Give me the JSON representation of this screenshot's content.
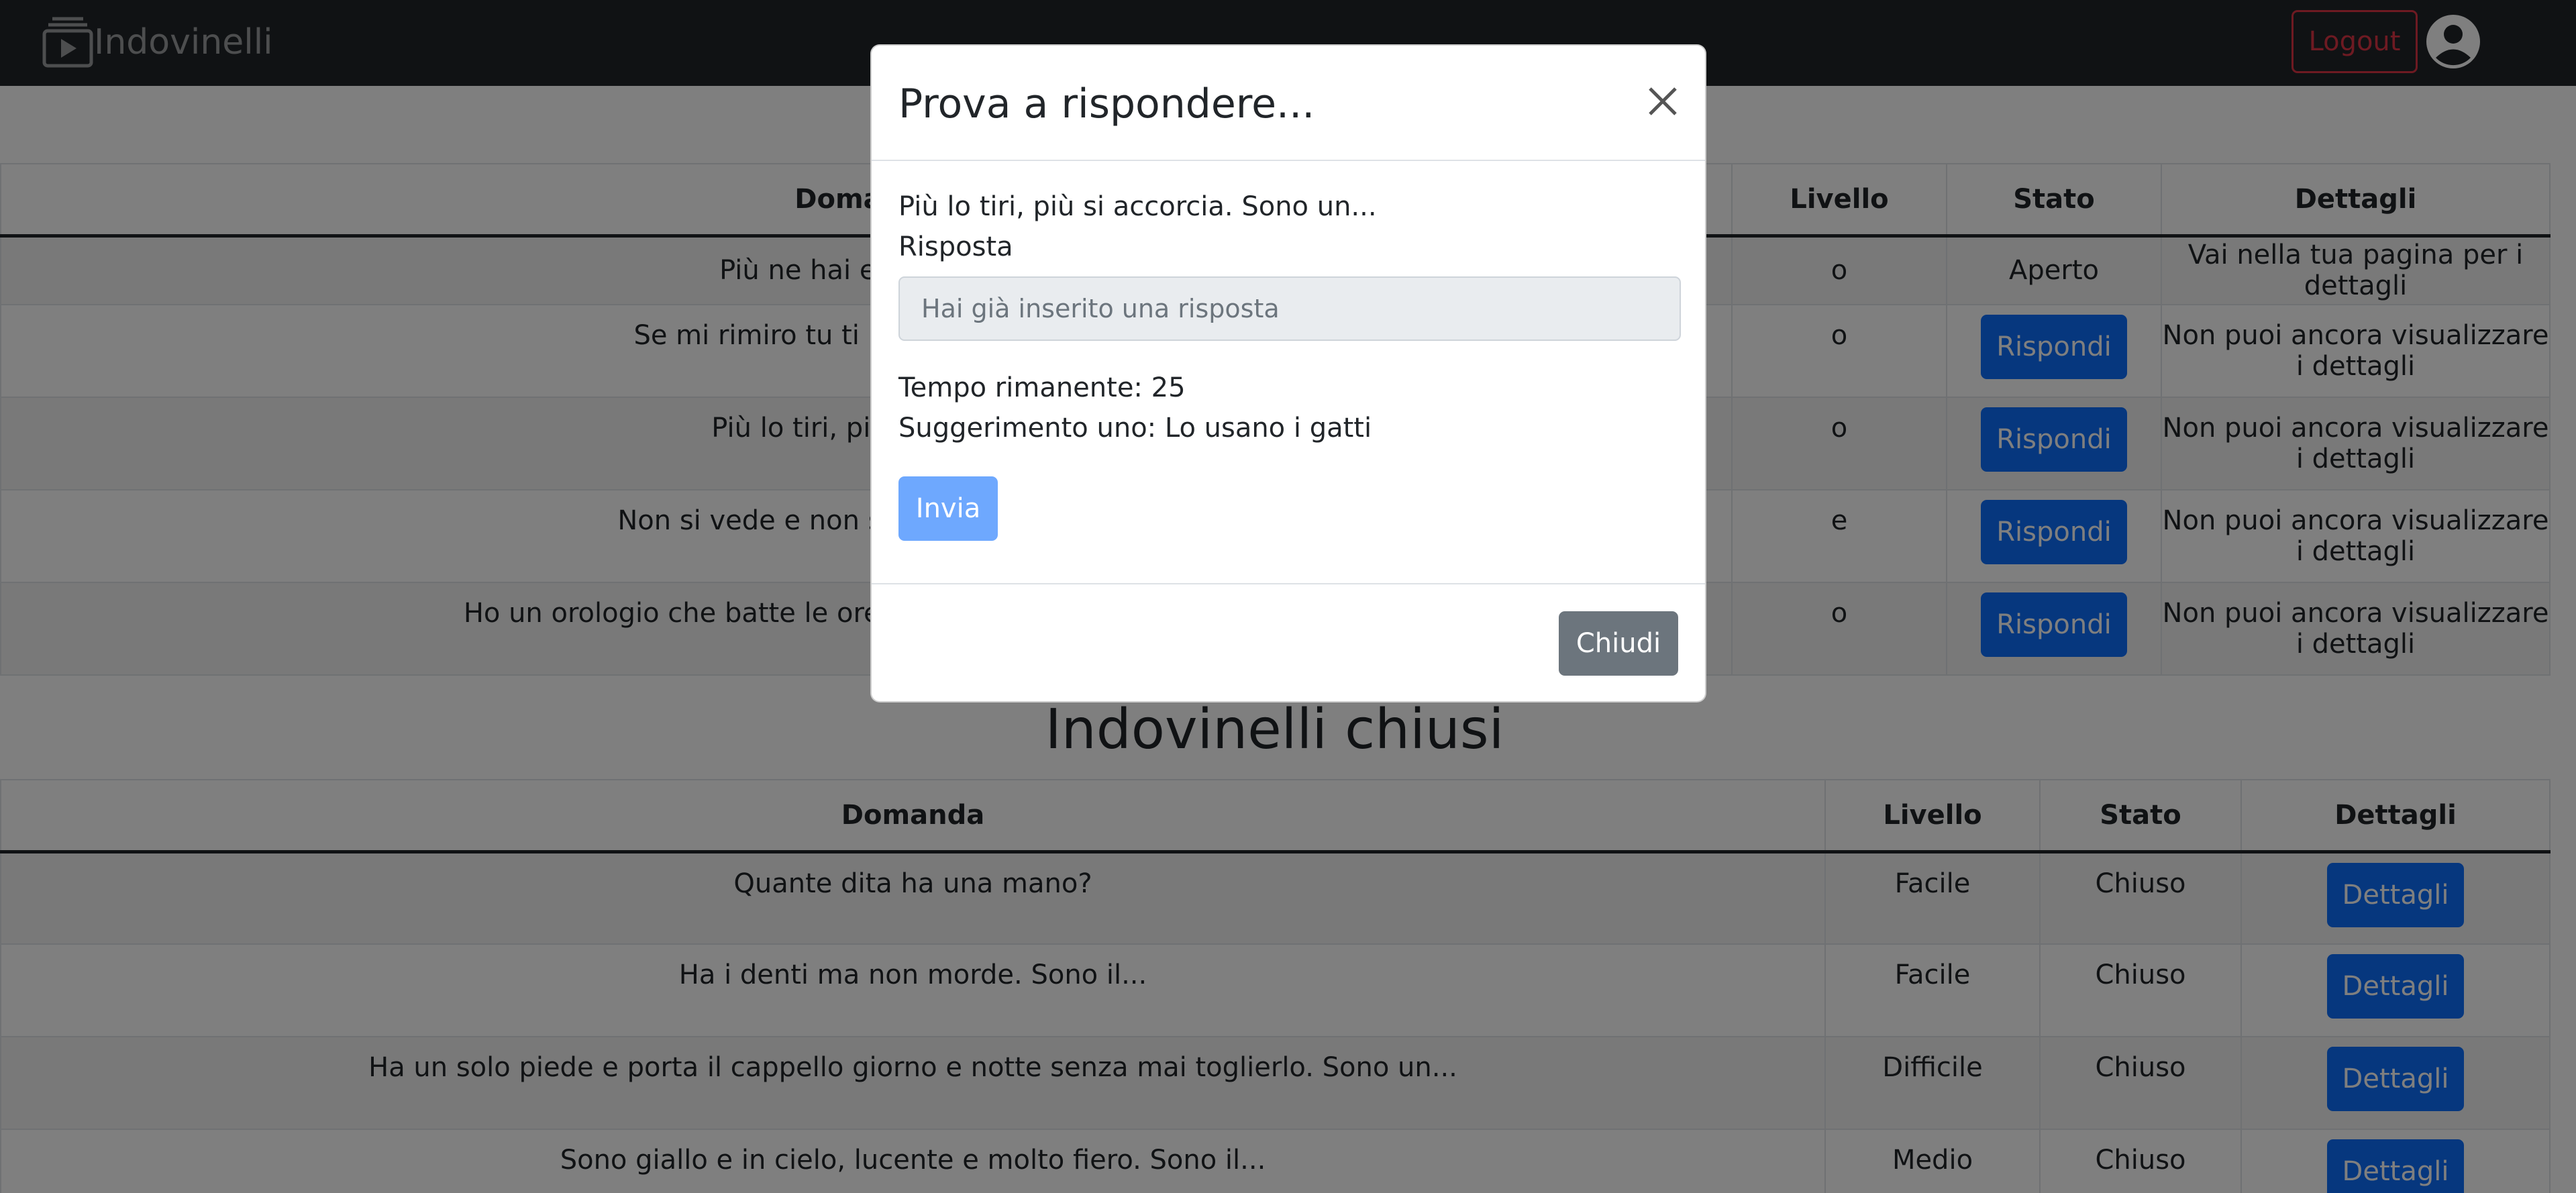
{
  "navbar": {
    "brand": "Indovinelli",
    "logout_label": "Logout"
  },
  "open_table": {
    "headers": [
      "Domanda",
      "Livello",
      "Stato",
      "Dettagli"
    ],
    "rows": [
      {
        "question": "Più ne hai e meno ten",
        "level": "o",
        "state": "Aperto",
        "details": "Vai nella tua pagina per i dettagli"
      },
      {
        "question": "Se mi rimiro tu ti rimiri; se io mi rit",
        "level": "o",
        "action": "Rispondi",
        "details": "Non puoi ancora visualizzare i dettagli"
      },
      {
        "question": "Più lo tiri, più si accorci",
        "level": "o",
        "action": "Rispondi",
        "details": "Non puoi ancora visualizzare i dettagli"
      },
      {
        "question": "Non si vede e non si tocca, esce sem",
        "level": "e",
        "action": "Rispondi",
        "details": "Non puoi ancora visualizzare i dettagli"
      },
      {
        "question": "Ho un orologio che batte le ore, non ha le lancette e quadra",
        "level": "o",
        "action": "Rispondi",
        "details": "Non puoi ancora visualizzare i dettagli"
      }
    ]
  },
  "closed_section": {
    "title": "Indovinelli chiusi"
  },
  "closed_table": {
    "headers": [
      "Domanda",
      "Livello",
      "Stato",
      "Dettagli"
    ],
    "rows": [
      {
        "question": "Quante dita ha una mano?",
        "level": "Facile",
        "state": "Chiuso",
        "action": "Dettagli"
      },
      {
        "question": "Ha i denti ma non morde. Sono il...",
        "level": "Facile",
        "state": "Chiuso",
        "action": "Dettagli"
      },
      {
        "question": "Ha un solo piede e porta il cappello giorno e notte senza mai toglierlo. Sono un...",
        "level": "Difficile",
        "state": "Chiuso",
        "action": "Dettagli"
      },
      {
        "question": "Sono giallo e in cielo, lucente e molto fiero. Sono il...",
        "level": "Medio",
        "state": "Chiuso",
        "action": "Dettagli"
      }
    ]
  },
  "modal": {
    "title": "Prova a rispondere...",
    "question": "Più lo tiri, più si accorcia. Sono un...",
    "answer_label": "Risposta",
    "answer_placeholder": "Hai già inserito una risposta",
    "time_remaining": "Tempo rimanente: 25",
    "hint": "Suggerimento uno: Lo usano i gatti",
    "send_label": "Invia",
    "close_label": "Chiudi"
  },
  "colors": {
    "navbar_bg": "#212529",
    "primary": "#0d6efd",
    "primary_disabled": "#6ea8fe",
    "danger": "#dc3545",
    "secondary": "#6c757d"
  }
}
